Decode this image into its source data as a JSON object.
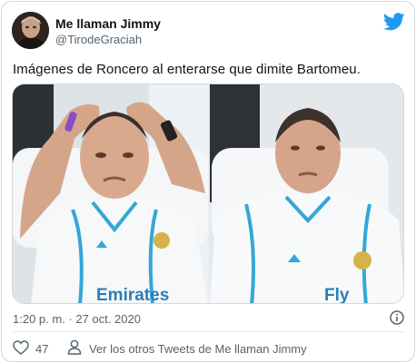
{
  "author": {
    "display_name": "Me llaman Jimmy",
    "handle": "@TirodeGraciah",
    "avatar_icon": "profile-avatar"
  },
  "platform_icon": "twitter-bird-icon",
  "tweet": {
    "text": "Imágenes de Roncero al enterarse que dimite Bartomeu."
  },
  "media": {
    "images": [
      {
        "icon": "photo-man-hands-on-head",
        "shirt_text": "Emirates"
      },
      {
        "icon": "photo-man-looking-up",
        "shirt_text": "Fly"
      }
    ]
  },
  "meta": {
    "timestamp": "1:20 p. m. · 27 oct. 2020",
    "info_icon": "info-icon"
  },
  "actions": {
    "like_count": "47",
    "more_tweets_label": "Ver los otros Tweets de Me llaman Jimmy"
  },
  "colors": {
    "twitter_blue": "#1d9bf0",
    "secondary_text": "#536471",
    "border": "#cfd9de"
  }
}
